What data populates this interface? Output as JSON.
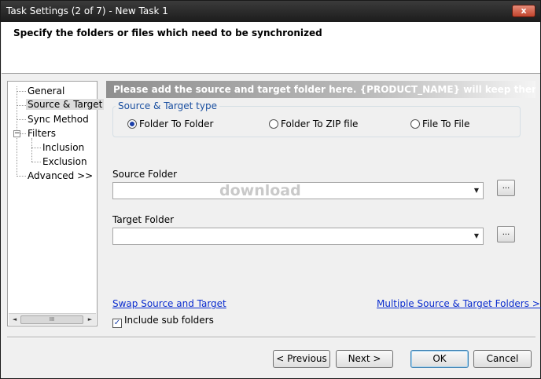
{
  "window": {
    "title": "Task Settings (2 of 7) - New Task 1",
    "close_label": "x"
  },
  "header": {
    "text": "Specify the folders or files which need to be synchronized"
  },
  "tree": {
    "items": [
      {
        "label": "General"
      },
      {
        "label": "Source & Target"
      },
      {
        "label": "Sync Method"
      },
      {
        "label": "Filters",
        "expander": "−"
      },
      {
        "label": "Inclusion"
      },
      {
        "label": "Exclusion"
      },
      {
        "label": "Advanced >>"
      }
    ],
    "scroll_left": "◄",
    "scroll_right": "►",
    "scroll_thumb": "III"
  },
  "panel": {
    "banner": "Please add the source and target folder here. {PRODUCT_NAME} will keep them in sync.",
    "type_group_title": "Source & Target type",
    "radios": [
      {
        "label": "Folder To Folder",
        "checked": true
      },
      {
        "label": "Folder To ZIP file",
        "checked": false
      },
      {
        "label": "File To File",
        "checked": false
      }
    ],
    "source_label": "Source Folder",
    "source_value": "",
    "target_label": "Target Folder",
    "target_value": "",
    "dropdown_arrow": "▼",
    "browse_label": "...",
    "watermark": "download",
    "swap_link": "Swap Source and Target",
    "multiple_link": "Multiple Source & Target Folders >>",
    "include_sub_label": "Include sub folders",
    "include_sub_checked": true,
    "check_mark": "✓"
  },
  "buttons": {
    "previous": "< Previous",
    "next": "Next >",
    "ok": "OK",
    "cancel": "Cancel"
  }
}
